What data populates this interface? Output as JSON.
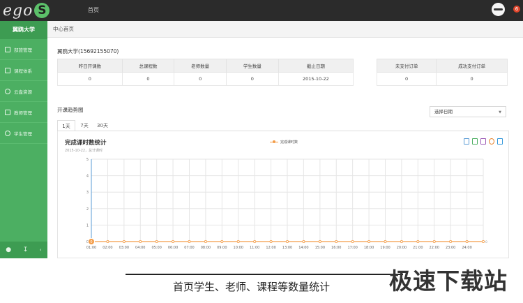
{
  "topbar": {
    "logo_text": "ego",
    "logo_s": "S",
    "home": "首页",
    "badge": "6"
  },
  "sidebar": {
    "school": "翼鸥大学",
    "items": [
      {
        "label": "部旅管理",
        "icon": "calendar-icon"
      },
      {
        "label": "课程体系",
        "icon": "document-icon"
      },
      {
        "label": "云盘资源",
        "icon": "cloud-icon"
      },
      {
        "label": "教师管理",
        "icon": "teacher-icon"
      },
      {
        "label": "学生管理",
        "icon": "student-icon"
      }
    ],
    "footer_icons": [
      "user-icon",
      "download-icon",
      "collapse-icon"
    ]
  },
  "breadcrumb": "中心首页",
  "account": "翼鸥大学(15692155070)",
  "stats": {
    "headers": [
      "昨日开课数",
      "总课程数",
      "老师数量",
      "学生数量",
      "截止日期"
    ],
    "values": [
      "0",
      "0",
      "0",
      "0",
      "2015-10-22"
    ]
  },
  "orders": {
    "headers": [
      "未支付订单",
      "成功支付订单"
    ],
    "values": [
      "0",
      "0"
    ]
  },
  "trend": {
    "title": "开课趋势图",
    "select_label": "选择日期",
    "tabs": [
      "1天",
      "7天",
      "30天"
    ],
    "active_tab": 0
  },
  "chart_data": {
    "type": "line",
    "title": "完成课时数统计",
    "subtitle": "2015-10-22，总计课时",
    "series": [
      {
        "name": "完成课时数",
        "color": "#f39c47",
        "values": [
          0,
          0,
          0,
          0,
          0,
          0,
          0,
          0,
          0,
          0,
          0,
          0,
          0,
          0,
          0,
          0,
          0,
          0,
          0,
          0,
          0,
          0,
          0,
          0,
          0
        ]
      }
    ],
    "categories": [
      "01:00",
      "02:00",
      "03:00",
      "04:00",
      "05:00",
      "06:00",
      "07:00",
      "08:00",
      "09:00",
      "10:00",
      "11:00",
      "12:00",
      "13:00",
      "14:00",
      "15:00",
      "16:00",
      "17:00",
      "18:00",
      "19:00",
      "20:00",
      "21:00",
      "22:00",
      "23:00",
      "24:00"
    ],
    "x_end_label": "0",
    "first_point_label": "0",
    "ylim": [
      0,
      5
    ],
    "yticks": [
      "0",
      "1",
      "2",
      "3",
      "4",
      "5"
    ],
    "grid": true,
    "legend_position": "top-center"
  },
  "caption": "首页学生、老师、课程等数量统计",
  "watermark": "极速下载站"
}
